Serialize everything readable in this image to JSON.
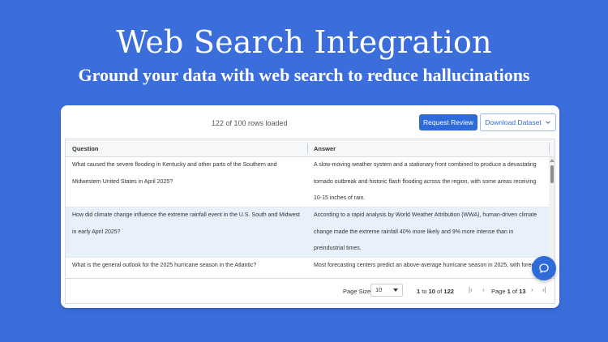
{
  "hero": {
    "title": "Web Search Integration",
    "subtitle": "Ground your data with web search to reduce hallucinations"
  },
  "toolbar": {
    "rows_loaded": "122 of 100 rows loaded",
    "request_review_label": "Request Review",
    "download_label": "Download Dataset"
  },
  "grid": {
    "columns": [
      "Question",
      "Answer"
    ],
    "rows": [
      {
        "question_lines": [
          "What caused the severe flooding in Kentucky and other parts of the Southern and",
          "Midwestern United States in April 2025?"
        ],
        "answer_lines": [
          "A slow-moving weather system and a stationary front combined to produce a devastating",
          "tornado outbreak and historic flash flooding across the region, with some areas receiving",
          "10-15 inches of rain."
        ]
      },
      {
        "question_lines": [
          "How did climate change influence the extreme rainfall event in the U.S. South and Midwest",
          "in early April 2025?"
        ],
        "answer_lines": [
          "According to a rapid analysis by World Weather Attribution (WWA), human-driven climate",
          "change made the extreme rainfall 40% more likely and 9% more intense than in",
          "preindustrial times."
        ]
      },
      {
        "question_lines": [
          "What is the general outlook for the 2025 hurricane season in the Atlantic?"
        ],
        "answer_lines": [
          "Most forecasting centers predict an above-average hurricane season in 2025, with foreca"
        ]
      }
    ]
  },
  "pager": {
    "page_size_label": "Page Size:",
    "page_size_value": "10",
    "range_start": "1",
    "range_to": "to",
    "range_end": "10",
    "range_of": "of",
    "range_total": "122",
    "page_word": "Page",
    "page_current": "1",
    "page_of": "of",
    "page_total": "13"
  },
  "icons": {
    "dropdown": "chevron-down-icon",
    "chat": "chat-bubble-icon"
  },
  "colors": {
    "background": "#3b6ddb",
    "primary": "#2f6bd8",
    "selected_row": "#e8f1fb"
  }
}
